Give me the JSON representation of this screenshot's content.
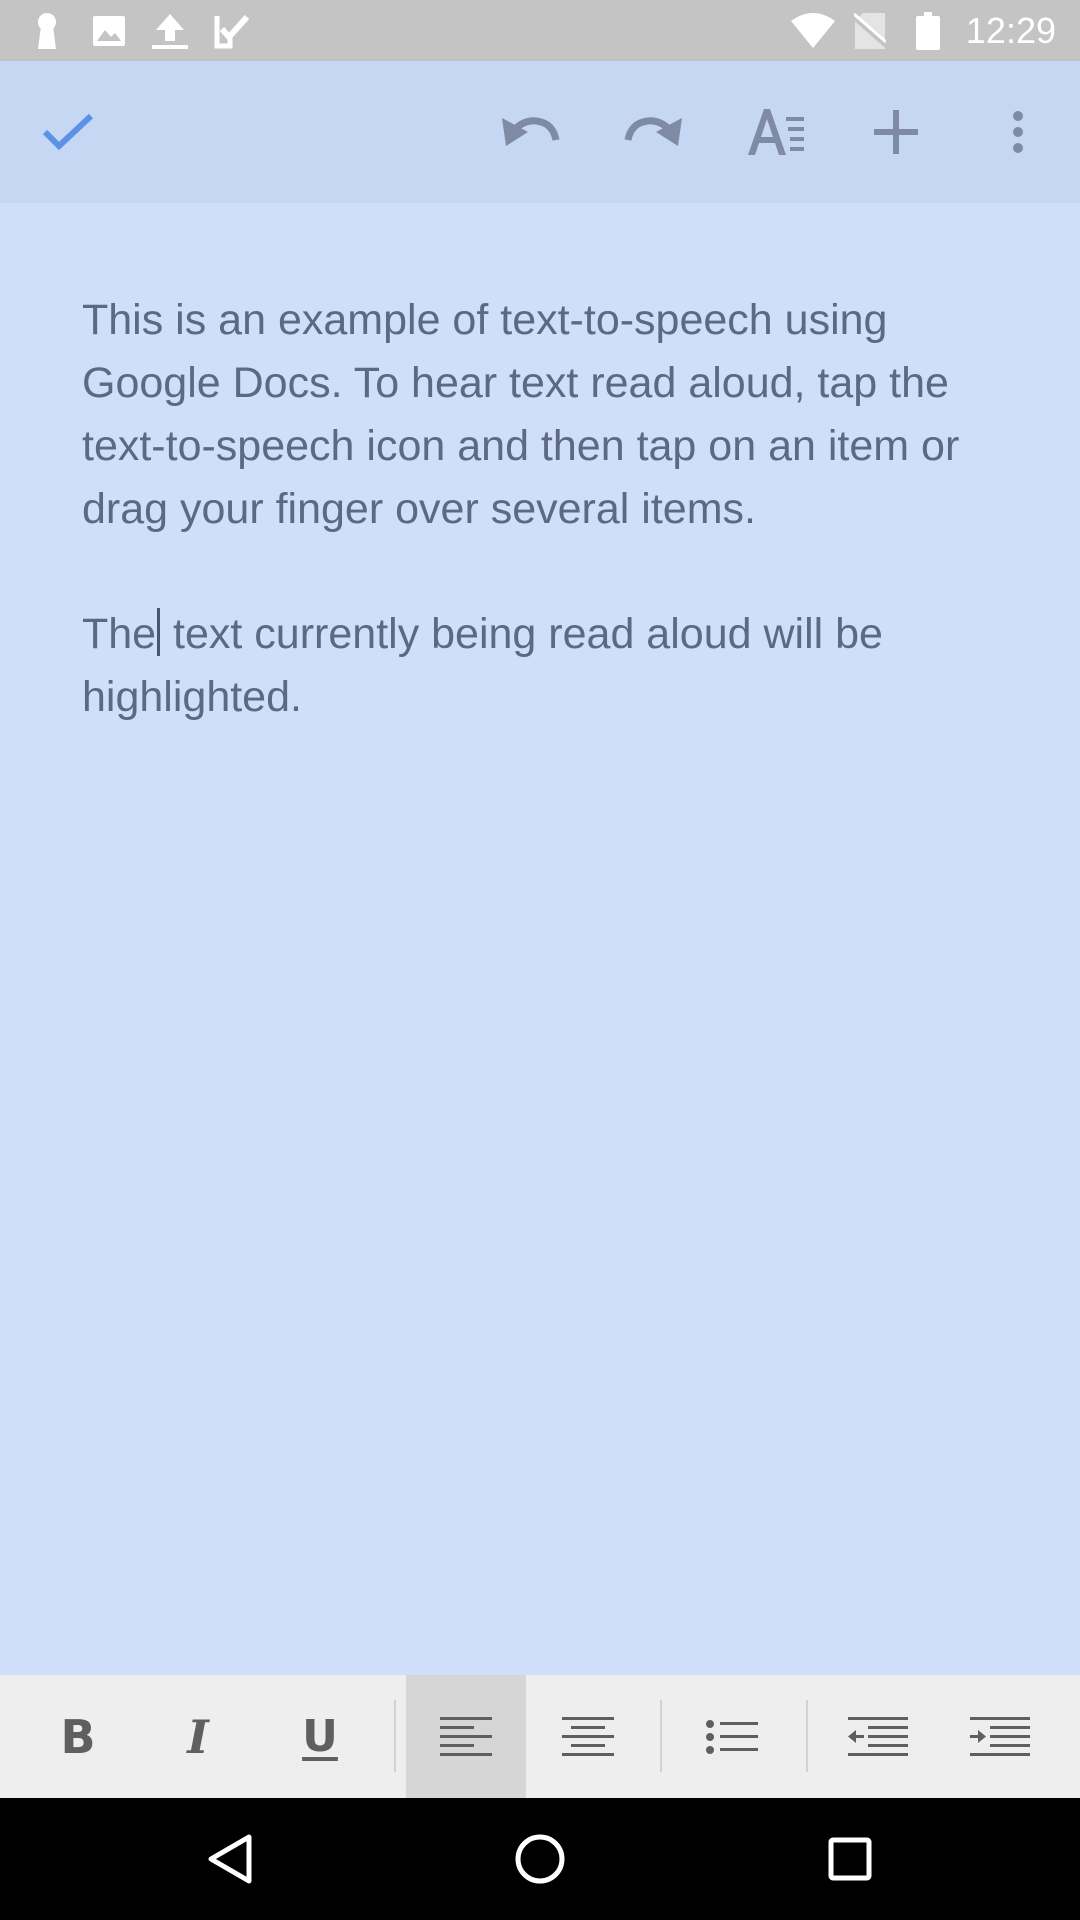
{
  "status_bar": {
    "time": "12:29",
    "left_icons": [
      "keyhole-icon",
      "image-icon",
      "upload-icon",
      "task-check-icon"
    ],
    "right_icons": [
      "wifi-icon",
      "no-sim-icon",
      "battery-icon"
    ]
  },
  "toolbar": {
    "done_icon": "checkmark-icon",
    "actions": [
      "undo-icon",
      "redo-icon",
      "text-format-icon",
      "add-icon",
      "more-vert-icon"
    ],
    "accent_color": "#5b92e5"
  },
  "document": {
    "paragraph_1": "This is an example of text-to-speech using Google Docs. To hear text read aloud, tap the text-to-speech icon and then tap on an item or drag your finger over several items.",
    "paragraph_2_before_cursor": "The",
    "paragraph_2_after_cursor": " text currently being read aloud will be highlighted.",
    "text_color": "#5c6886",
    "background_color": "#cfdef9"
  },
  "format_bar": {
    "bold_label": "B",
    "italic_label": "I",
    "underline_label": "U",
    "active_button": "align-left",
    "buttons": [
      "bold",
      "italic",
      "underline",
      "align-left",
      "align-center",
      "bulleted-list",
      "decrease-indent",
      "increase-indent"
    ]
  },
  "nav_bar": {
    "buttons": [
      "back-icon",
      "home-icon",
      "recents-icon"
    ]
  }
}
